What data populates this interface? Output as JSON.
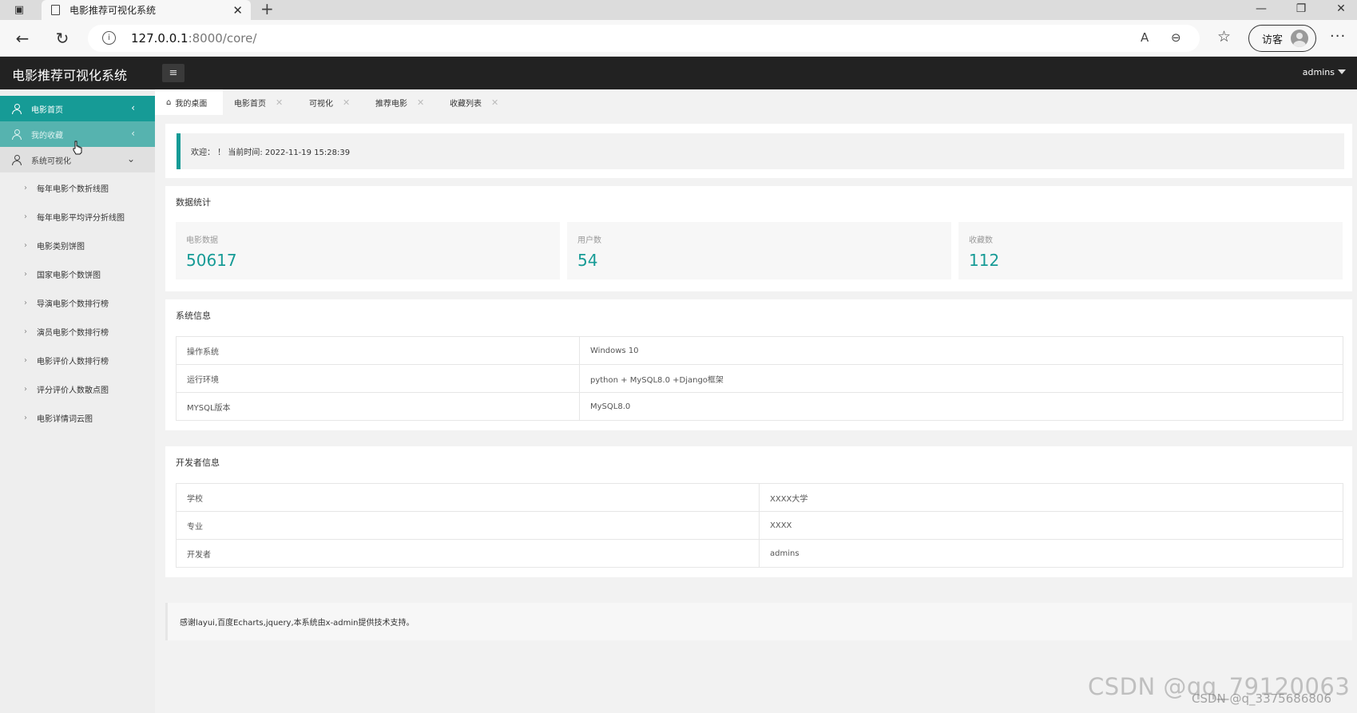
{
  "browser": {
    "tab_title": "电影推荐可视化系统",
    "tab_close": "✕",
    "new_tab": "+",
    "url_host": "127.0.0.1",
    "url_rest": ":8000/core/",
    "profile_label": "访客",
    "window_controls": [
      "—",
      "❐",
      "✕"
    ]
  },
  "header": {
    "logo": "电影推荐可视化系统",
    "menu_icon": "≡",
    "user": "admins"
  },
  "sidebar": {
    "items": [
      {
        "label": "电影首页",
        "arrow": "‹"
      },
      {
        "label": "我的收藏",
        "arrow": "‹"
      },
      {
        "label": "系统可视化",
        "arrow": "⌄"
      }
    ],
    "sub_items": [
      "每年电影个数折线图",
      "每年电影平均评分折线图",
      "电影类别饼图",
      "国家电影个数饼图",
      "导演电影个数排行榜",
      "演员电影个数排行榜",
      "电影评价人数排行榜",
      "评分评价人数散点图",
      "电影详情词云图"
    ]
  },
  "tabs": [
    {
      "label": "我的桌面"
    },
    {
      "label": "电影首页"
    },
    {
      "label": "可视化"
    },
    {
      "label": "推荐电影"
    },
    {
      "label": "收藏列表"
    }
  ],
  "welcome": {
    "text": "欢迎： ！ 当前时间: 2022-11-19 15:28:39"
  },
  "stats": {
    "title": "数据统计",
    "items": [
      {
        "label": "电影数据",
        "value": "50617"
      },
      {
        "label": "用户数",
        "value": "54"
      },
      {
        "label": "收藏数",
        "value": "112"
      }
    ]
  },
  "system_info": {
    "title": "系统信息",
    "rows": [
      {
        "key": "操作系统",
        "value": "Windows 10"
      },
      {
        "key": "运行环境",
        "value": "python + MySQL8.0 +Django框架"
      },
      {
        "key": "MYSQL版本",
        "value": "MySQL8.0"
      }
    ]
  },
  "developer_info": {
    "title": "开发者信息",
    "rows": [
      {
        "key": "学校",
        "value": "XXXX大学"
      },
      {
        "key": "专业",
        "value": "XXXX"
      },
      {
        "key": "开发者",
        "value": "admins"
      }
    ]
  },
  "footer": "感谢layui,百度Echarts,jquery,本系统由x-admin提供技术支持。",
  "watermark": "CSDN @qq_79120063",
  "watermark2": "CSDN @q_3375686806",
  "colors": {
    "accent": "#169b96",
    "header_bg": "#222222",
    "sidebar_bg": "#eeeeee"
  }
}
